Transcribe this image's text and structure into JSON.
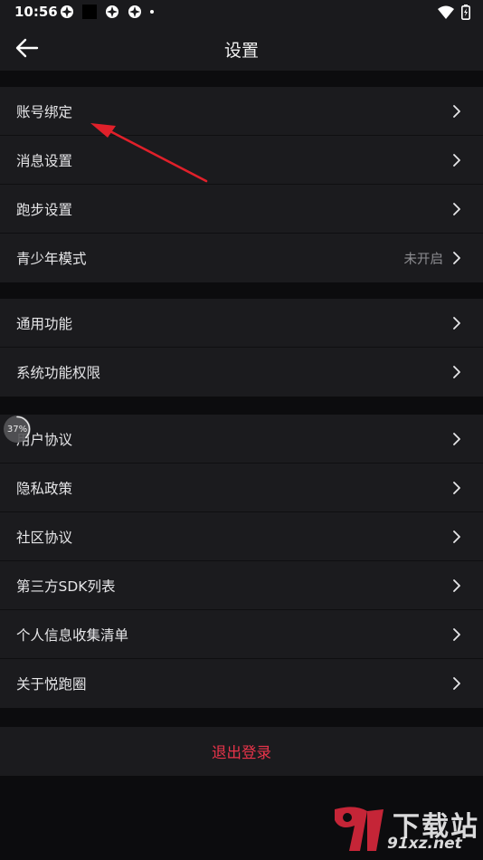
{
  "status_bar": {
    "time": "10:56"
  },
  "header": {
    "title": "设置"
  },
  "groups": [
    {
      "items": [
        {
          "label": "账号绑定"
        },
        {
          "label": "消息设置"
        },
        {
          "label": "跑步设置"
        },
        {
          "label": "青少年模式",
          "value": "未开启"
        }
      ]
    },
    {
      "items": [
        {
          "label": "通用功能"
        },
        {
          "label": "系统功能权限"
        }
      ]
    },
    {
      "items": [
        {
          "label": "用户协议"
        },
        {
          "label": "隐私政策"
        },
        {
          "label": "社区协议"
        },
        {
          "label": "第三方SDK列表"
        },
        {
          "label": "个人信息收集清单"
        },
        {
          "label": "关于悦跑圈"
        }
      ]
    }
  ],
  "logout": {
    "label": "退出登录"
  },
  "progress_badge": {
    "text": "37%",
    "percent": 37
  },
  "watermark": {
    "main": "下载站",
    "sub": "91xz.net"
  },
  "colors": {
    "background": "#0c0c0e",
    "row_background": "#1b1b1e",
    "logout_text": "#e8344a",
    "annotation_arrow": "#e0202a"
  }
}
